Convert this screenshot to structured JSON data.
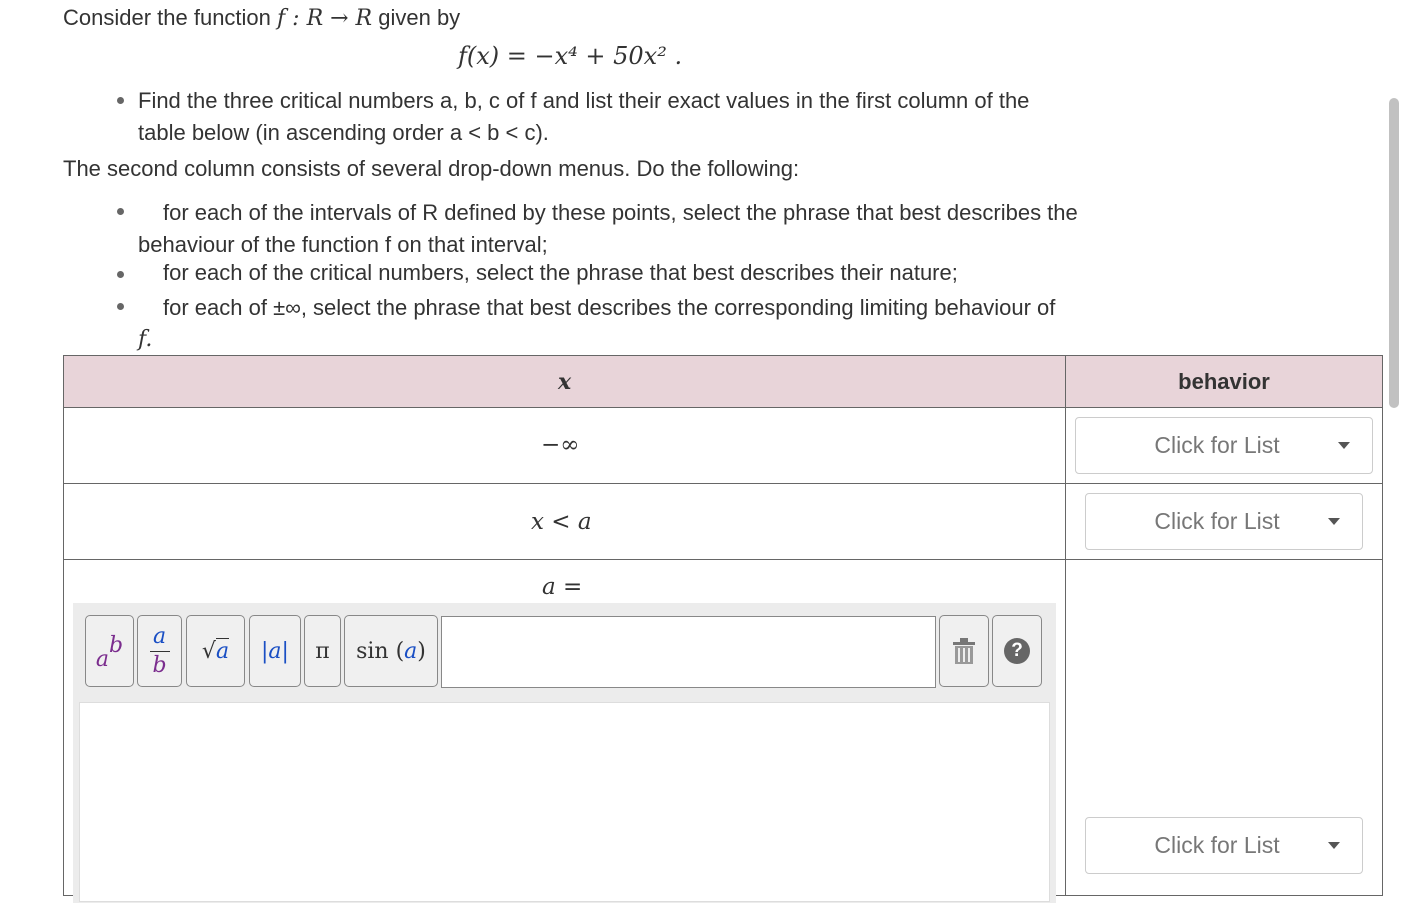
{
  "problem": {
    "intro_prefix": "Consider the function ",
    "intro_math": "f : R → R",
    "intro_suffix": " given by",
    "formula": "f(x) = −x⁴ + 50x² .",
    "bullet1_line1": "Find the three critical numbers a, b, c of f and list their exact values in the first column of the",
    "bullet1_line2": "table below (in ascending order a < b < c).",
    "second_column_text": "The second column consists of several drop-down menus.  Do the following:",
    "bullet2_line1": "for each of the intervals of R defined by these points, select the phrase that best describes the",
    "bullet2_line2": "behaviour of the function f on that interval;",
    "bullet3": "for each of the critical numbers, select the phrase that best describes their nature;",
    "bullet4_line1": "for each of ±∞, select the phrase that best describes the corresponding limiting behaviour of",
    "bullet4_line2": "f."
  },
  "table": {
    "col_x": "x",
    "col_behavior": "behavior",
    "rows": [
      {
        "x": "−∞",
        "dropdown": "Click for List"
      },
      {
        "x": "x < a",
        "dropdown": "Click for List"
      },
      {
        "x": "a =",
        "dropdown": "Click for List"
      }
    ]
  },
  "toolbar": {
    "power": "ab",
    "fraction_top": "a",
    "fraction_bottom": "b",
    "sqrt": "√a",
    "abs": "|a|",
    "pi": "π",
    "sin": "sin (a)",
    "help": "?"
  }
}
